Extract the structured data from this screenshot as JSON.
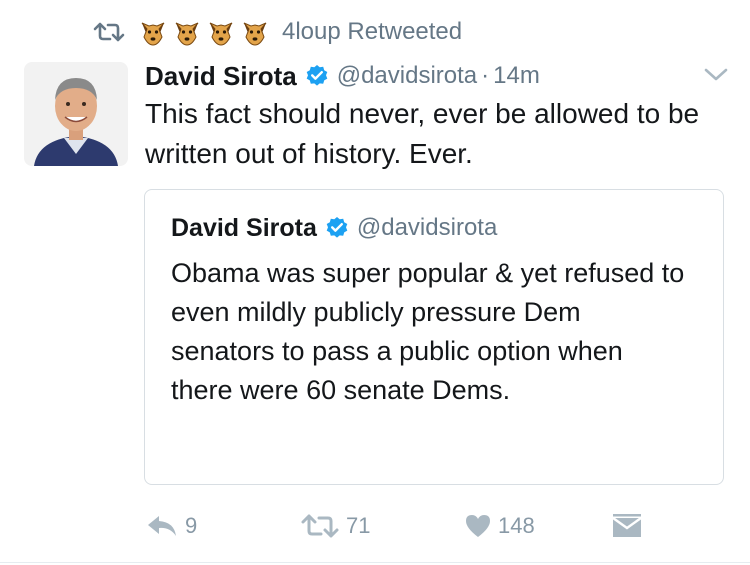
{
  "retweet_context": {
    "emojis": [
      "dog-face",
      "dog-face",
      "dog-face",
      "dog-face"
    ],
    "text": "4loup Retweeted"
  },
  "tweet": {
    "author_name": "David Sirota",
    "handle": "@davidsirota",
    "separator": "·",
    "time": "14m",
    "text": "This fact should never, ever be allowed to be written out of history. Ever."
  },
  "quoted_tweet": {
    "author_name": "David Sirota",
    "handle": "@davidsirota",
    "text": "Obama was super popular & yet refused to even mildly publicly pressure Dem senators to pass a public option when there were 60 senate Dems."
  },
  "actions": {
    "reply_count": "9",
    "retweet_count": "71",
    "like_count": "148"
  },
  "colors": {
    "verified": "#1da1f2",
    "muted": "#657786",
    "action_icon": "#8899a6",
    "text": "#14171a"
  }
}
